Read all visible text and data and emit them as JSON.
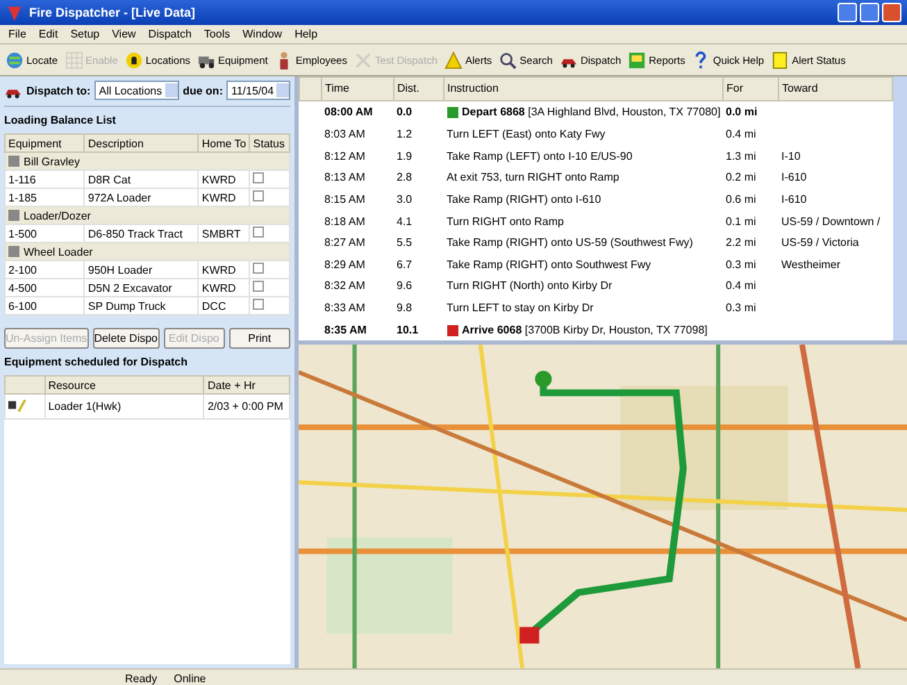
{
  "window": {
    "title": "Fire Dispatcher - [Live Data]"
  },
  "menu": [
    "File",
    "Edit",
    "Setup",
    "View",
    "Dispatch",
    "Tools",
    "Window",
    "Help"
  ],
  "toolbar": [
    {
      "label": "Locate",
      "disabled": false
    },
    {
      "label": "Enable",
      "disabled": true
    },
    {
      "label": "Locations",
      "disabled": false
    },
    {
      "label": "Equipment",
      "disabled": false
    },
    {
      "label": "Employees",
      "disabled": false
    },
    {
      "label": "Test Dispatch",
      "disabled": true
    },
    {
      "label": "Alerts",
      "disabled": false
    },
    {
      "label": "Search",
      "disabled": false
    },
    {
      "label": "Dispatch",
      "disabled": false
    },
    {
      "label": "Reports",
      "disabled": false
    },
    {
      "label": "Quick Help",
      "disabled": false
    },
    {
      "label": "Alert Status",
      "disabled": false
    }
  ],
  "dispatch_bar": {
    "label": "Dispatch to:",
    "location": "All Locations",
    "due_label": "due on:",
    "date": "11/15/04"
  },
  "balance_list": {
    "title": "Loading Balance List",
    "columns": [
      "Equipment",
      "Description",
      "Home To",
      "Status"
    ],
    "groups": [
      {
        "name": "Bill Gravley",
        "expanded": true,
        "children": [
          {
            "equipment": "1-116",
            "description": "D8R Cat",
            "home": "KWRD",
            "checked": false
          },
          {
            "equipment": "1-185",
            "description": "972A Loader",
            "home": "KWRD",
            "checked": false
          }
        ]
      },
      {
        "name": "Loader/Dozer",
        "expanded": true,
        "children": [
          {
            "equipment": "1-500",
            "description": "D6-850 Track Tract",
            "home": "SMBRT",
            "checked": false
          }
        ]
      },
      {
        "name": "Wheel Loader",
        "expanded": true,
        "children": [
          {
            "equipment": "2-100",
            "description": "950H Loader",
            "home": "KWRD",
            "checked": false
          },
          {
            "equipment": "4-500",
            "description": "D5N 2 Excavator",
            "home": "KWRD",
            "checked": false
          },
          {
            "equipment": "6-100",
            "description": "SP Dump Truck",
            "home": "DCC",
            "checked": false
          }
        ]
      }
    ]
  },
  "buttons": [
    {
      "label": "Un-Assign Items",
      "disabled": true
    },
    {
      "label": "Delete Dispo",
      "disabled": false
    },
    {
      "label": "Edit Dispo",
      "disabled": true
    },
    {
      "label": "Print",
      "disabled": false
    }
  ],
  "scheduled": {
    "title": "Equipment scheduled for Dispatch",
    "columns": [
      "Resource",
      "Date + Hr"
    ],
    "rows": [
      {
        "resource": "Loader 1(Hwk)",
        "date": "2/03 + 0:00 PM"
      }
    ]
  },
  "route": {
    "columns": [
      "Time",
      "Dist.",
      "Instruction",
      "For",
      "Toward"
    ],
    "rows": [
      {
        "kind": "depart",
        "time": "08:00 AM",
        "dist": "0.0",
        "instruction": "Depart 6868",
        "address": "[3A Highland Blvd, Houston, TX 77080]",
        "for": "0.0 mi",
        "toward": ""
      },
      {
        "kind": "step",
        "time": "8:03 AM",
        "dist": "1.2",
        "instruction": "Turn LEFT (East) onto Katy Fwy",
        "for": "0.4 mi",
        "toward": ""
      },
      {
        "kind": "step",
        "time": "8:12 AM",
        "dist": "1.9",
        "instruction": "Take Ramp (LEFT) onto I-10 E/US-90",
        "for": "1.3 mi",
        "toward": "I-10"
      },
      {
        "kind": "step",
        "time": "8:13 AM",
        "dist": "2.8",
        "instruction": "At exit 753, turn RIGHT onto Ramp",
        "for": "0.2 mi",
        "toward": "I-610"
      },
      {
        "kind": "step",
        "time": "8:15 AM",
        "dist": "3.0",
        "instruction": "Take Ramp (RIGHT) onto I-610",
        "for": "0.6 mi",
        "toward": "I-610"
      },
      {
        "kind": "step",
        "time": "8:18 AM",
        "dist": "4.1",
        "instruction": "Turn RIGHT onto Ramp",
        "for": "0.1 mi",
        "toward": "US-59 / Downtown /"
      },
      {
        "kind": "step",
        "time": "8:27 AM",
        "dist": "5.5",
        "instruction": "Take Ramp (RIGHT) onto US-59 (Southwest Fwy)",
        "for": "2.2 mi",
        "toward": "US-59 / Victoria"
      },
      {
        "kind": "step",
        "time": "8:29 AM",
        "dist": "6.7",
        "instruction": "Take Ramp (RIGHT) onto Southwest Fwy",
        "for": "0.3 mi",
        "toward": "Westheimer"
      },
      {
        "kind": "step",
        "time": "8:32 AM",
        "dist": "9.6",
        "instruction": "Turn RIGHT (North) onto Kirby Dr",
        "for": "0.4 mi",
        "toward": ""
      },
      {
        "kind": "step",
        "time": "8:33 AM",
        "dist": "9.8",
        "instruction": "Turn LEFT to stay on Kirby Dr",
        "for": "0.3 mi",
        "toward": ""
      },
      {
        "kind": "arrive",
        "time": "8:35 AM",
        "dist": "10.1",
        "instruction": "Arrive 6068",
        "address": "[3700B Kirby Dr, Houston, TX 77098]",
        "for": "",
        "toward": ""
      }
    ]
  },
  "map": {
    "kind": "picture"
  },
  "status_bar": [
    "Ready",
    "Online"
  ]
}
